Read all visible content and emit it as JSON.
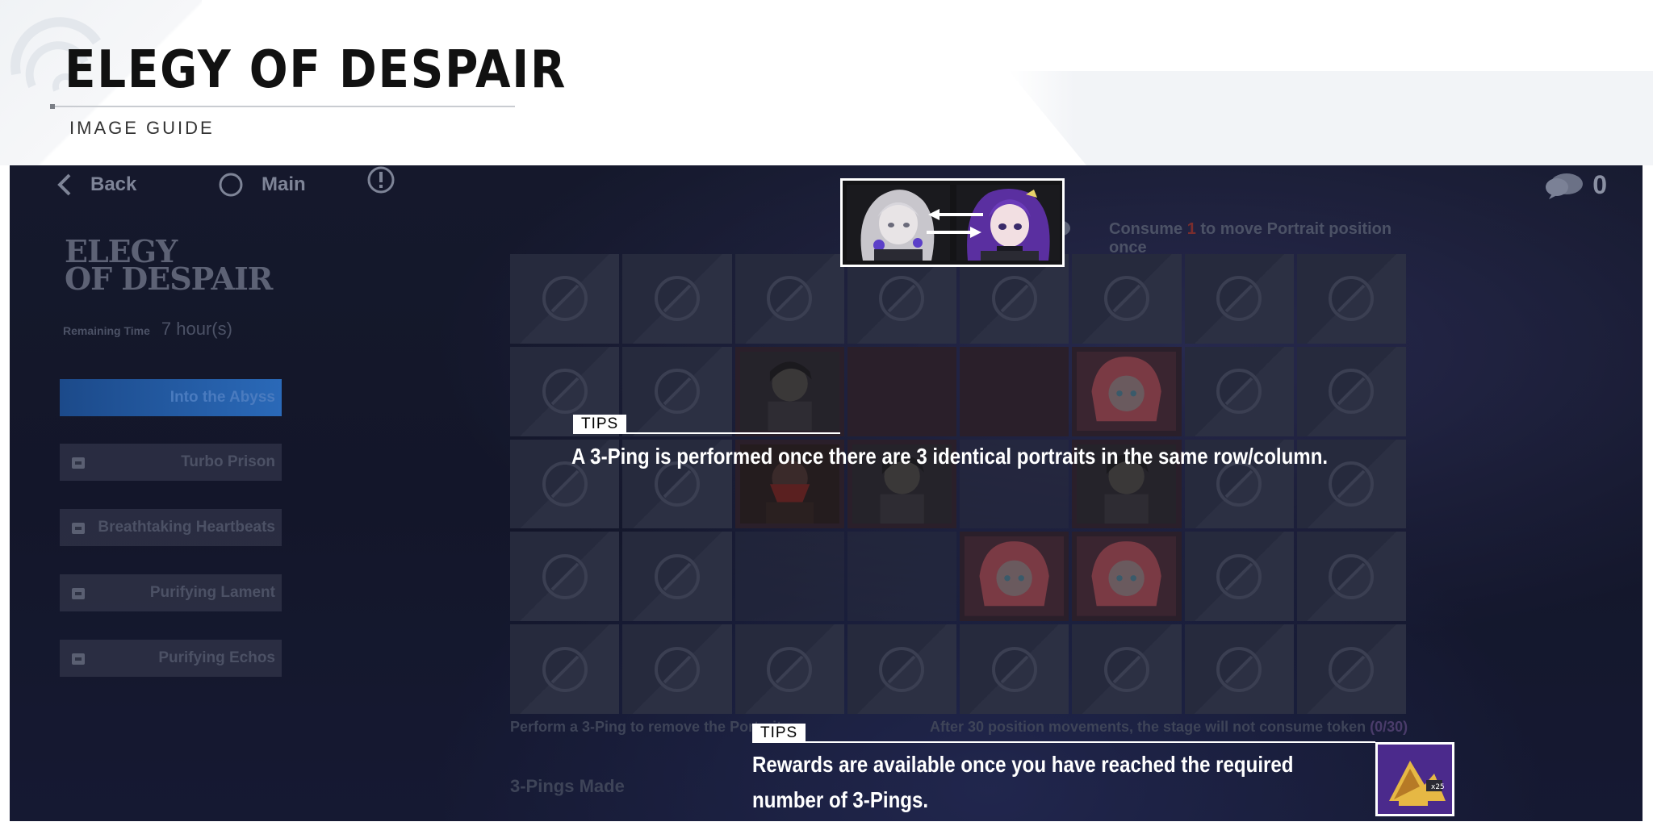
{
  "header": {
    "title": "ELEGY OF DESPAIR",
    "subtitle": "IMAGE GUIDE"
  },
  "topbar": {
    "back_label": "Back",
    "main_label": "Main",
    "token_count": "0"
  },
  "sidebar": {
    "logo_line1": "ELEGY",
    "logo_line2": "OF DESPAIR",
    "remaining_label": "Remaining Time",
    "remaining_value": "7 hour(s)",
    "stages": [
      {
        "label": "Into the Abyss",
        "locked": false,
        "active": true
      },
      {
        "label": "Turbo Prison",
        "locked": true,
        "active": false
      },
      {
        "label": "Breathtaking Heartbeats",
        "locked": true,
        "active": false
      },
      {
        "label": "Purifying Lament",
        "locked": true,
        "active": false
      },
      {
        "label": "Purifying Echos",
        "locked": true,
        "active": false
      }
    ]
  },
  "board": {
    "consume_pre": "Consume",
    "consume_count": "1",
    "consume_post": "to move Portrait position once",
    "bottom_left": "Perform a 3-Ping to remove the Portrait.",
    "bottom_right": "After 30 position movements, the stage will not consume token",
    "bottom_right_count": "(0/30)",
    "pings_label": "3-Pings Made"
  },
  "tips": {
    "tag": "TIPS",
    "tip1": "A 3-Ping is performed once there are 3 identical portraits in the same row/column.",
    "tip2_line1": "Rewards are available once you have reached the required",
    "tip2_line2": "number of 3-Pings."
  },
  "colors": {
    "accent": "#2a69b8",
    "highlight_red": "#c0392b"
  }
}
